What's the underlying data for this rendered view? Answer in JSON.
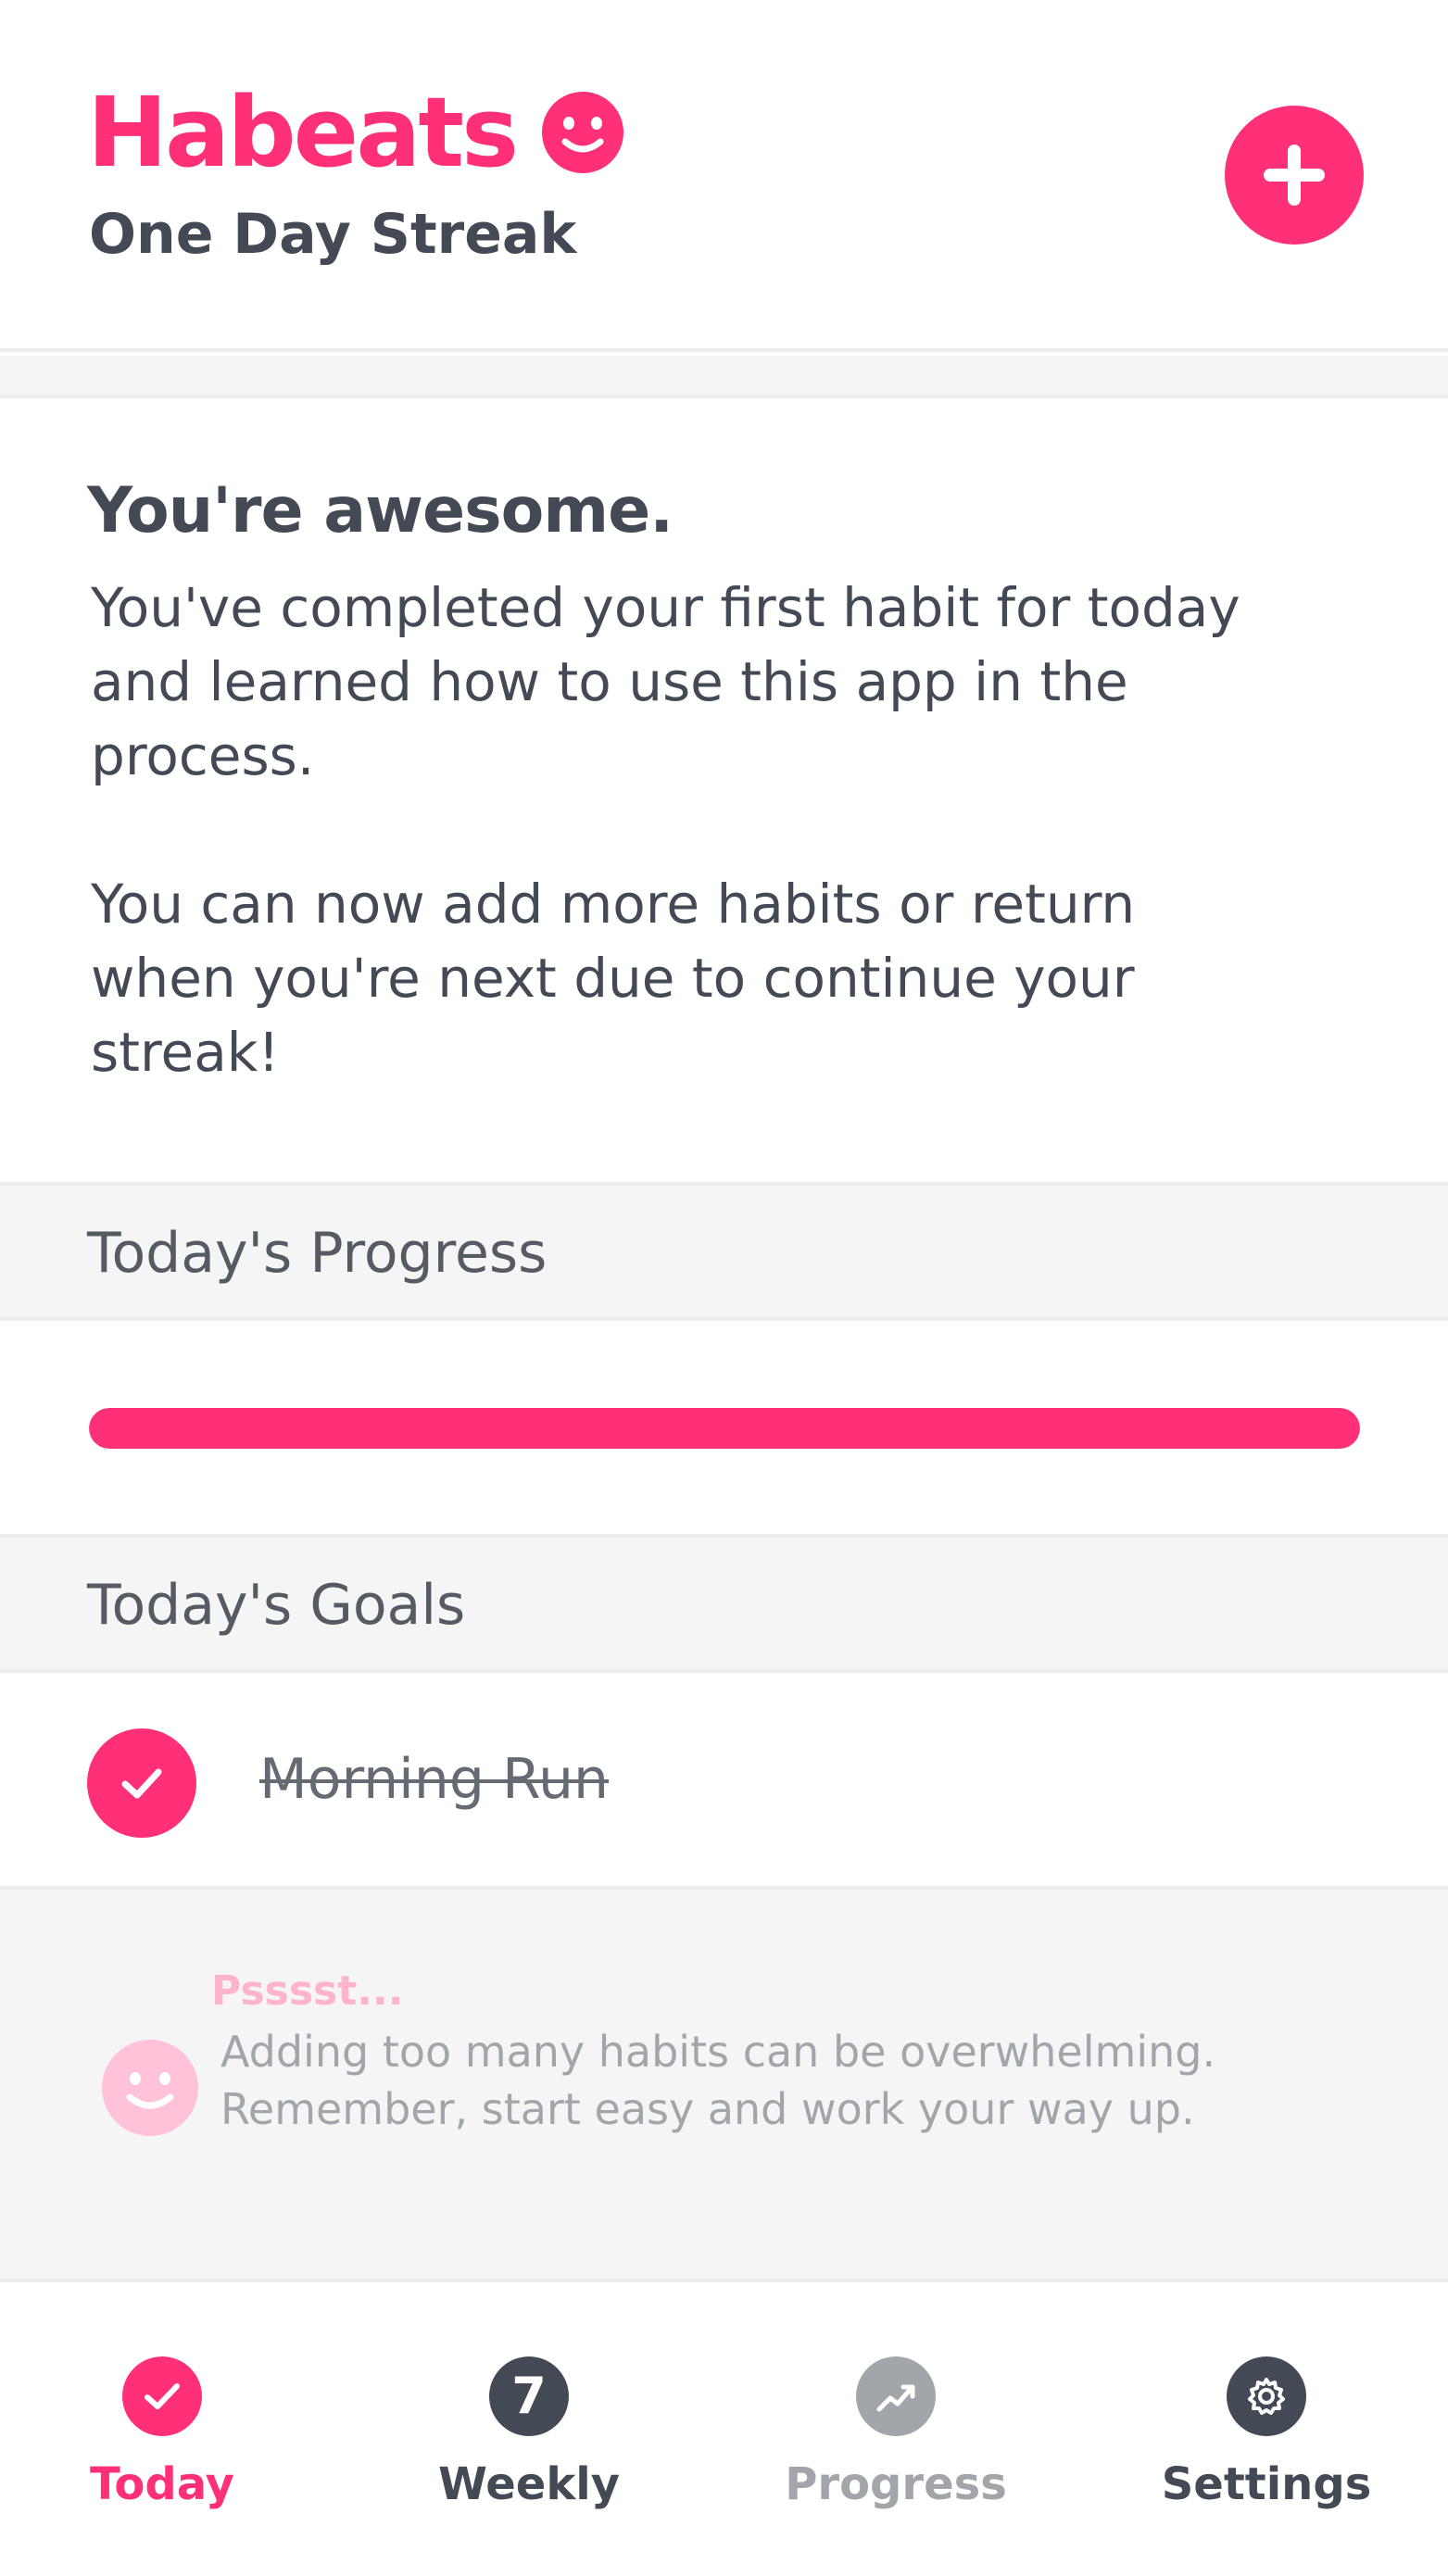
{
  "app": {
    "name": "Habeats",
    "streak": "One Day Streak"
  },
  "colors": {
    "accent": "#ff2f78",
    "text": "#444a55",
    "muted": "#a2a5aa",
    "section_bg": "#f5f5f5"
  },
  "header": {
    "logo_icon": "smiley-icon",
    "add_icon": "plus-icon"
  },
  "message": {
    "title": "You're awesome.",
    "body": "You've completed your first habit for today\nand learned how to use this app in the\nprocess.\n\nYou can now add more habits or return\nwhen you're next due to continue your\nstreak!"
  },
  "progress": {
    "header": "Today's Progress",
    "value": 1.0
  },
  "goals": {
    "header": "Today's Goals",
    "items": [
      {
        "label": "Morning Run",
        "completed": true
      }
    ]
  },
  "tip": {
    "title": "Psssst...",
    "text": "Adding too many habits can be overwhelming.\nRemember, start easy and work your way up."
  },
  "tabs": [
    {
      "label": "Today",
      "icon": "check-circle-icon",
      "active": true
    },
    {
      "label": "Weekly",
      "icon": "seven-icon",
      "badge": "7",
      "active": false
    },
    {
      "label": "Progress",
      "icon": "trend-up-icon",
      "active": false
    },
    {
      "label": "Settings",
      "icon": "gear-icon",
      "active": false
    }
  ]
}
